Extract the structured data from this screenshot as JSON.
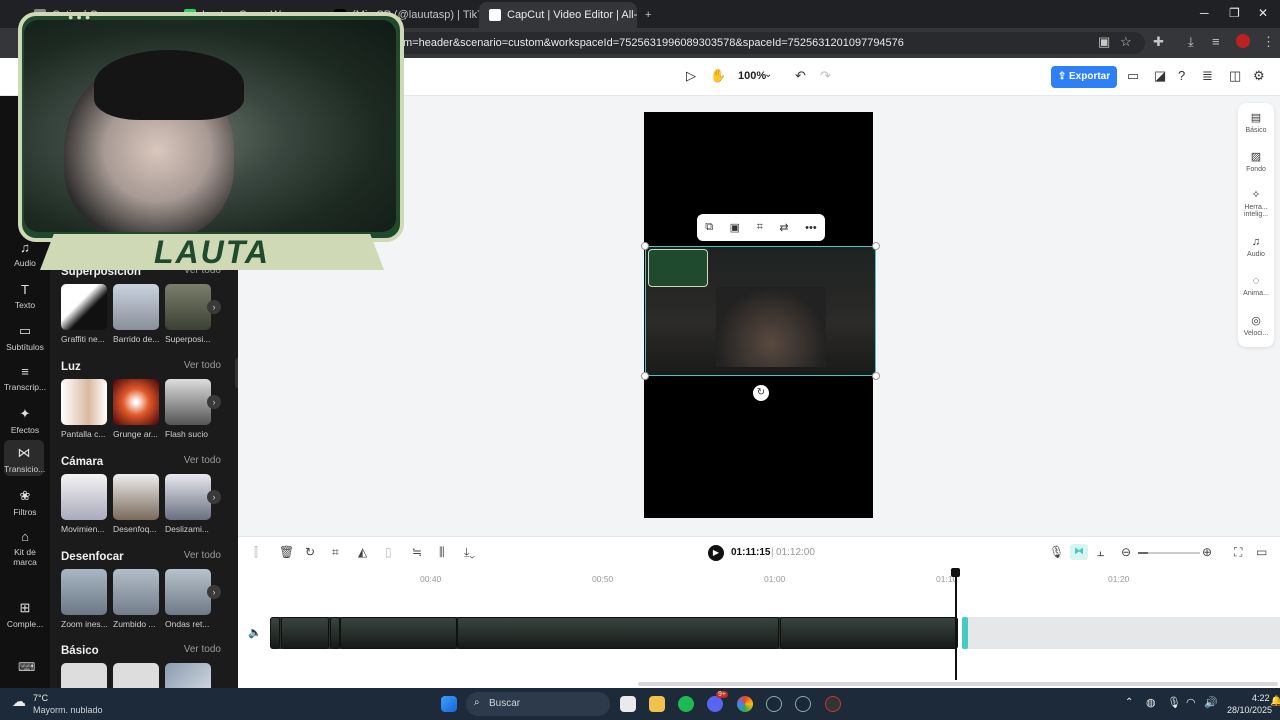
{
  "browser": {
    "tabs": [
      {
        "label": "Cuti... | Con...",
        "active": false
      },
      {
        "label": "Lauta...Cas... Wa...",
        "active": false
      },
      {
        "label": "(Mi...SP (@lauutasp) | TikTo",
        "active": false
      },
      {
        "label": "CapCut | Video Editor | All-In-O",
        "active": true
      }
    ],
    "new_tab": "+",
    "url": "m=header&scenario=custom&workspaceId=7525631996089303578&spaceId=7525631201097794576"
  },
  "toolbar": {
    "zoom": "100%",
    "export_label": "Exportar"
  },
  "leftnav": [
    {
      "label": "Audio",
      "icon": "music-icon",
      "glyph": "♫"
    },
    {
      "label": "Texto",
      "icon": "text-icon",
      "glyph": "T"
    },
    {
      "label": "Subtítulos",
      "icon": "subtitles-icon",
      "glyph": "▭"
    },
    {
      "label": "Transcrip...",
      "icon": "transcript-icon",
      "glyph": "≡"
    },
    {
      "label": "Efectos",
      "icon": "effects-icon",
      "glyph": "✦"
    },
    {
      "label": "Transicio...",
      "icon": "transitions-icon",
      "glyph": "⋈"
    },
    {
      "label": "Filtros",
      "icon": "filters-icon",
      "glyph": "❀"
    },
    {
      "label": "Kit de marca",
      "icon": "brand-kit-icon",
      "glyph": "⌂"
    },
    {
      "label": "Comple...",
      "icon": "plugins-icon",
      "glyph": "⊞"
    }
  ],
  "panel": {
    "more": "Ver todo",
    "sections": [
      {
        "title": "Superposición",
        "items": [
          "Graffiti ne...",
          "Barrido de...",
          "Superposi..."
        ]
      },
      {
        "title": "Luz",
        "items": [
          "Pantalla c...",
          "Grunge ar...",
          "Flash sucio"
        ]
      },
      {
        "title": "Cámara",
        "items": [
          "Movimien...",
          "Desenfoq...",
          "Deslizami..."
        ]
      },
      {
        "title": "Desenfocar",
        "items": [
          "Zoom ines...",
          "Zumbido ...",
          "Ondas ret..."
        ]
      },
      {
        "title": "Básico",
        "items": [
          "",
          "",
          ""
        ]
      }
    ]
  },
  "rightbar": [
    {
      "label": "Básico",
      "icon": "basic-icon",
      "glyph": "▤"
    },
    {
      "label": "Fondo",
      "icon": "background-icon",
      "glyph": "▨"
    },
    {
      "label": "Herra... intelig...",
      "icon": "smart-tools-icon",
      "glyph": "✧"
    },
    {
      "label": "Audio",
      "icon": "audio-icon",
      "glyph": "♫"
    },
    {
      "label": "Anima...",
      "icon": "animation-icon",
      "glyph": "◌"
    },
    {
      "label": "Veloci...",
      "icon": "speed-icon",
      "glyph": "◎"
    }
  ],
  "timeline": {
    "current_time": "01:11:15",
    "separator": "|",
    "total_time": "01:12:00",
    "ticks": [
      "00:40",
      "00:50",
      "01:00",
      "01:10",
      "01:20"
    ]
  },
  "webcam": {
    "name": "LAUTA"
  },
  "taskbar": {
    "weather_temp": "7°C",
    "weather_desc": "Mayorm. nublado",
    "search_placeholder": "Buscar",
    "time": "4:22",
    "date": "28/10/2025",
    "badge": "9+"
  },
  "colors": {
    "accent": "#2f7ff7",
    "selection": "#46c9c1",
    "frame_green": "#1f4a2e",
    "frame_cream": "#cfd9b5"
  }
}
